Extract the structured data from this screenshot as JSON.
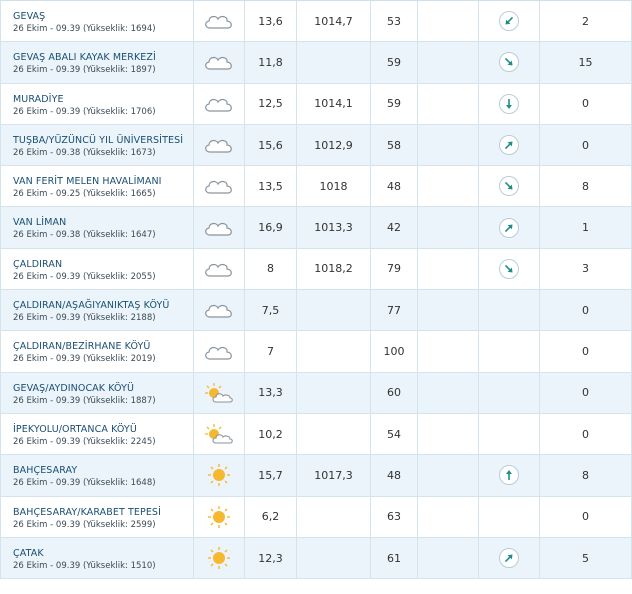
{
  "colors": {
    "row_alt": "#eaf4fa",
    "border": "#d5e3ec",
    "station_text": "#1a4e73",
    "arrow": "#1f8f86",
    "sun": "#f5b82e"
  },
  "rows": [
    {
      "name": "GEVAŞ",
      "meta": "26 Ekim - 09.39 (Yükseklik: 1694)",
      "icon": "cloud-icon",
      "temp": "13,6",
      "pressure": "1014,7",
      "humidity": "53",
      "wind_dir": "arrow-down-left-icon",
      "wind_speed": "2"
    },
    {
      "name": "GEVAŞ ABALI KAYAK MERKEZİ",
      "meta": "26 Ekim - 09.39 (Yükseklik: 1897)",
      "icon": "cloud-icon",
      "temp": "11,8",
      "pressure": "",
      "humidity": "59",
      "wind_dir": "arrow-down-right-icon",
      "wind_speed": "15"
    },
    {
      "name": "MURADİYE",
      "meta": "26 Ekim - 09.39 (Yükseklik: 1706)",
      "icon": "cloud-icon",
      "temp": "12,5",
      "pressure": "1014,1",
      "humidity": "59",
      "wind_dir": "arrow-down-icon",
      "wind_speed": "0"
    },
    {
      "name": "TUŞBA/YÜZÜNCÜ YIL ÜNİVERSİTESİ",
      "meta": "26 Ekim - 09.38 (Yükseklik: 1673)",
      "icon": "cloud-icon",
      "temp": "15,6",
      "pressure": "1012,9",
      "humidity": "58",
      "wind_dir": "arrow-up-right-icon",
      "wind_speed": "0"
    },
    {
      "name": "VAN FERİT MELEN HAVALİMANI",
      "meta": "26 Ekim - 09.25 (Yükseklik: 1665)",
      "icon": "cloud-icon",
      "temp": "13,5",
      "pressure": "1018",
      "humidity": "48",
      "wind_dir": "arrow-down-right-icon",
      "wind_speed": "8"
    },
    {
      "name": "VAN LİMAN",
      "meta": "26 Ekim - 09.38 (Yükseklik: 1647)",
      "icon": "cloud-icon",
      "temp": "16,9",
      "pressure": "1013,3",
      "humidity": "42",
      "wind_dir": "arrow-up-right-icon",
      "wind_speed": "1"
    },
    {
      "name": "ÇALDIRAN",
      "meta": "26 Ekim - 09.39 (Yükseklik: 2055)",
      "icon": "cloud-icon",
      "temp": "8",
      "pressure": "1018,2",
      "humidity": "79",
      "wind_dir": "arrow-down-right-icon",
      "wind_speed": "3"
    },
    {
      "name": "ÇALDIRAN/AŞAĞIYANIKTAŞ KÖYÜ",
      "meta": "26 Ekim - 09.39 (Yükseklik: 2188)",
      "icon": "cloud-icon",
      "temp": "7,5",
      "pressure": "",
      "humidity": "77",
      "wind_dir": "",
      "wind_speed": "0"
    },
    {
      "name": "ÇALDIRAN/BEZİRHANE KÖYÜ",
      "meta": "26 Ekim - 09.39 (Yükseklik: 2019)",
      "icon": "cloud-icon",
      "temp": "7",
      "pressure": "",
      "humidity": "100",
      "wind_dir": "",
      "wind_speed": "0"
    },
    {
      "name": "GEVAŞ/AYDINOCAK KÖYÜ",
      "meta": "26 Ekim - 09.39 (Yükseklik: 1887)",
      "icon": "partly-sunny-icon",
      "temp": "13,3",
      "pressure": "",
      "humidity": "60",
      "wind_dir": "",
      "wind_speed": "0"
    },
    {
      "name": "İPEKYOLU/ORTANCA KÖYÜ",
      "meta": "26 Ekim - 09.39 (Yükseklik: 2245)",
      "icon": "partly-sunny-icon",
      "temp": "10,2",
      "pressure": "",
      "humidity": "54",
      "wind_dir": "",
      "wind_speed": "0"
    },
    {
      "name": "BAHÇESARAY",
      "meta": "26 Ekim - 09.39 (Yükseklik: 1648)",
      "icon": "sun-icon",
      "temp": "15,7",
      "pressure": "1017,3",
      "humidity": "48",
      "wind_dir": "arrow-up-icon",
      "wind_speed": "8"
    },
    {
      "name": "BAHÇESARAY/KARABET TEPESİ",
      "meta": "26 Ekim - 09.39 (Yükseklik: 2599)",
      "icon": "sun-icon",
      "temp": "6,2",
      "pressure": "",
      "humidity": "63",
      "wind_dir": "",
      "wind_speed": "0"
    },
    {
      "name": "ÇATAK",
      "meta": "26 Ekim - 09.39 (Yükseklik: 1510)",
      "icon": "sun-icon",
      "temp": "12,3",
      "pressure": "",
      "humidity": "61",
      "wind_dir": "arrow-up-right-icon",
      "wind_speed": "5"
    }
  ]
}
